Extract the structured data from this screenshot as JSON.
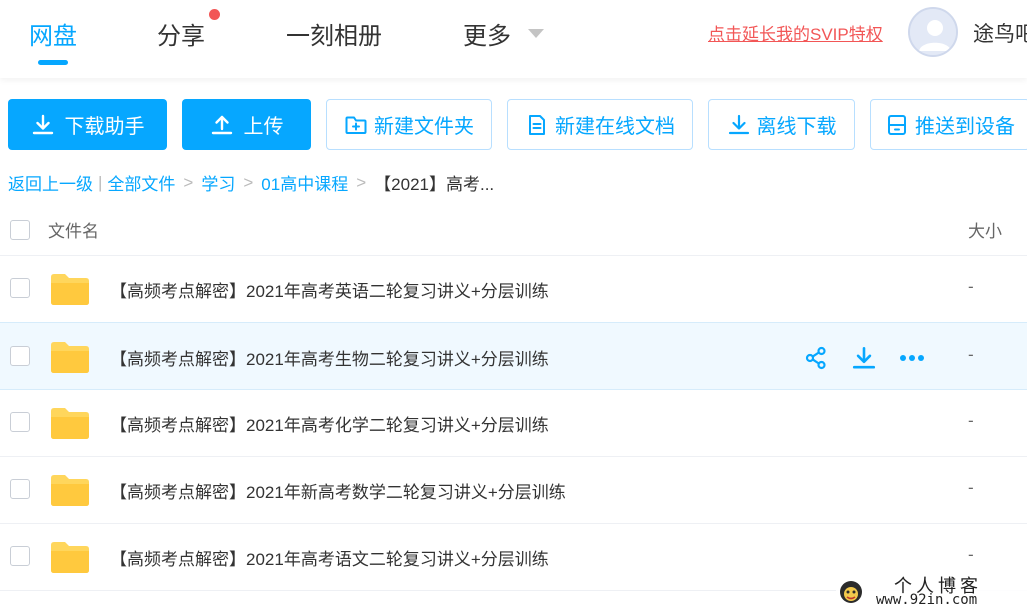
{
  "nav": {
    "items": [
      {
        "label": "网盘",
        "active": true
      },
      {
        "label": "分享",
        "has_dot": true
      },
      {
        "label": "一刻相册"
      },
      {
        "label": "更多",
        "has_caret": true
      }
    ],
    "svip_link": "点击延长我的SVIP特权",
    "username": "途鸟吧",
    "icons": {
      "caret": "chevron-down-icon",
      "avatar": "user-avatar-icon"
    },
    "colors": {
      "accent": "#06a7ff",
      "badge": "#f25656"
    }
  },
  "toolbar": {
    "buttons": [
      {
        "label": "下载助手",
        "icon": "download-icon",
        "style": "primary"
      },
      {
        "label": "上传",
        "icon": "upload-icon",
        "style": "primary"
      },
      {
        "label": "新建文件夹",
        "icon": "folder-plus-icon",
        "style": "outline"
      },
      {
        "label": "新建在线文档",
        "icon": "document-icon",
        "style": "outline"
      },
      {
        "label": "离线下载",
        "icon": "download-icon",
        "style": "outline"
      },
      {
        "label": "推送到设备",
        "icon": "device-icon",
        "style": "outline"
      }
    ]
  },
  "breadcrumb": {
    "back": "返回上一级",
    "divider": "|",
    "items": [
      "全部文件",
      "学习",
      "01高中课程"
    ],
    "separator": ">",
    "current": "【2021】高考..."
  },
  "table": {
    "headers": {
      "name": "文件名",
      "size": "大小"
    },
    "rows": [
      {
        "name": "【高频考点解密】2021年高考英语二轮复习讲义+分层训练",
        "size": "-",
        "hover": false
      },
      {
        "name": "【高频考点解密】2021年高考生物二轮复习讲义+分层训练",
        "size": "-",
        "hover": true
      },
      {
        "name": "【高频考点解密】2021年高考化学二轮复习讲义+分层训练",
        "size": "-",
        "hover": false
      },
      {
        "name": "【高频考点解密】2021年新高考数学二轮复习讲义+分层训练",
        "size": "-",
        "hover": false
      },
      {
        "name": "【高频考点解密】2021年高考语文二轮复习讲义+分层训练",
        "size": "-",
        "hover": false
      }
    ],
    "row_actions": [
      "share-icon",
      "download-icon",
      "more-icon"
    ]
  },
  "watermark": {
    "title": "个人博客",
    "url": "www.92in.com"
  }
}
